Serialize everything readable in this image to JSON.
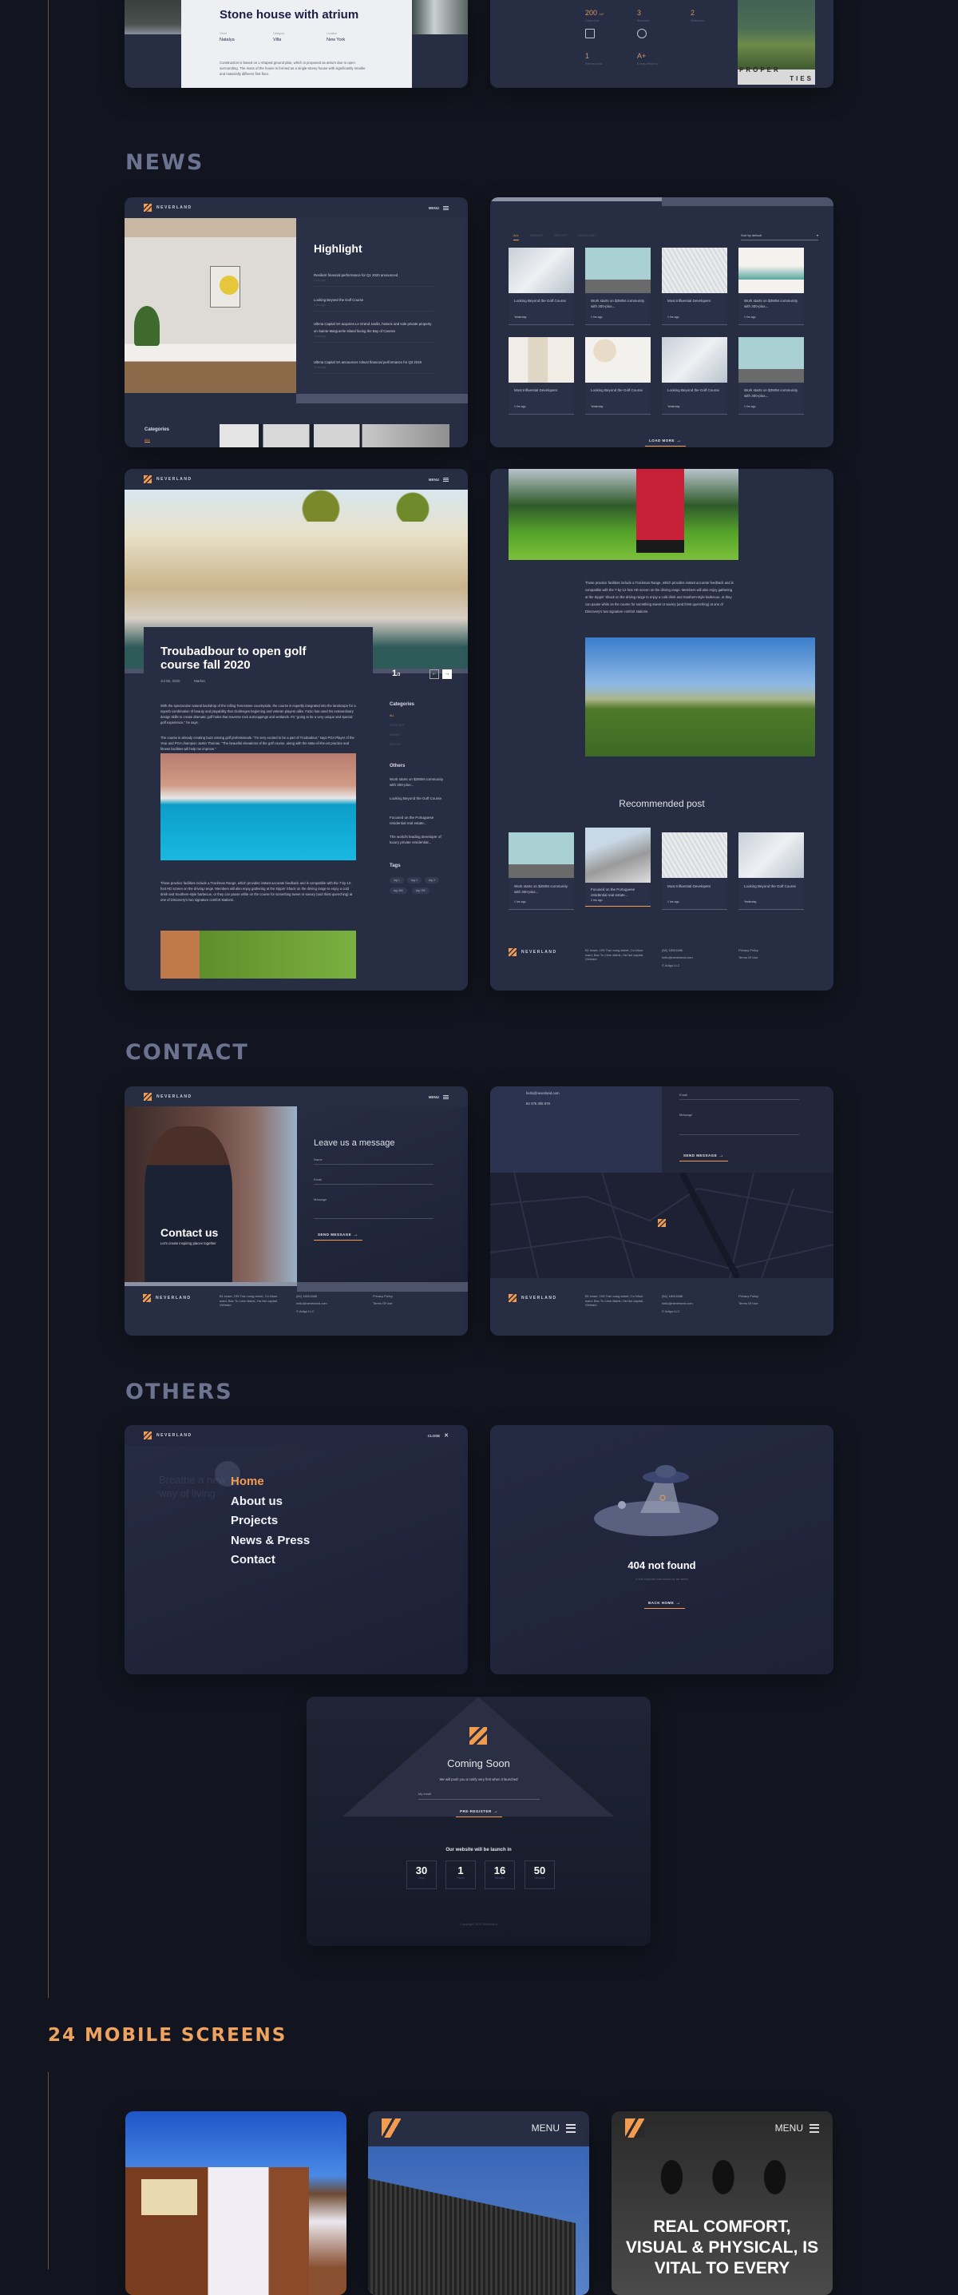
{
  "brand": {
    "name": "NEVERLAND",
    "menu": "MENU",
    "close": "CLOSE",
    "accent": "#f39c50"
  },
  "sections": {
    "news": "NEWS",
    "contact": "CONTACT",
    "others": "OTHERS",
    "mobile": "24 MOBILE SCREENS"
  },
  "project": {
    "title": "Stone house with atrium",
    "meta": [
      {
        "label": "Client",
        "value": "Natalya"
      },
      {
        "label": "Category",
        "value": "Villa"
      },
      {
        "label": "Location",
        "value": "New York"
      }
    ],
    "description": "Construction is based on L-shaped ground plan, which is proposed as atrium due to open surrounding. The mass of the house is formed as a single-storey house with significantly smaller and materially different first floor."
  },
  "properties": {
    "stats": [
      {
        "icon": "area-icon",
        "value": "200",
        "unit": "m2",
        "label": "Gross Area"
      },
      {
        "icon": "bed-icon",
        "value": "3",
        "label": "Bedrooms"
      },
      {
        "icon": "bath-icon",
        "value": "2",
        "label": "Restrooms"
      },
      {
        "icon": "garage-icon",
        "value": "1",
        "label": "Parking spots"
      },
      {
        "icon": "energy-icon",
        "value": "A+",
        "label": "Energy efficiency"
      }
    ],
    "image_caption_1": "PROPER",
    "image_caption_2": "TIES"
  },
  "highlight": {
    "title": "Highlight",
    "items": [
      {
        "title": "Resilient financial performance for Q1 2020 announced",
        "time": "1 hrs ago"
      },
      {
        "title": "Looking Beyond the Golf Course",
        "time": "3 hrs ago"
      },
      {
        "title": "Ultima Capital SA acquires Le Grand Jardin, historic and sole private property on Sainte-Marguerite Island facing the Bay of Cannes",
        "time": "Yesterday"
      },
      {
        "title": "Ultima Capital SA announces robust financial performance for Q3 2019",
        "time": "Yesterday"
      }
    ],
    "categories_title": "Categories",
    "categories_first": "ALL"
  },
  "news_list": {
    "tabs": [
      "ALL",
      "MARKET",
      "REPORT",
      "HIGH LIGHT"
    ],
    "sort": "Sort by default",
    "items": [
      {
        "title": "Looking Beyond the Golf Course",
        "time": "Yesterday"
      },
      {
        "title": "Work starts on $250M community with 300-plus...",
        "time": "1 hrs ago"
      },
      {
        "title": "Most Influential Developers",
        "time": "1 hrs ago"
      },
      {
        "title": "Work starts on $250M community with 300-plus...",
        "time": "1 hrs ago"
      },
      {
        "title": "Most Influential Developers",
        "time": "1 hrs ago"
      },
      {
        "title": "Looking Beyond the Golf Course",
        "time": "Yesterday"
      },
      {
        "title": "Looking Beyond the Golf Course",
        "time": "Yesterday"
      },
      {
        "title": "Work starts on $250M community with 300-plus...",
        "time": "1 hrs ago"
      }
    ],
    "load_more": "LOAD MORE"
  },
  "article": {
    "title": "Troubadbour to open golf course fall 2020",
    "date": "Jul 06, 2020",
    "category": "Market",
    "slide_current": "1",
    "slide_total": "/3",
    "p1": "With the spectacular natural backdrop of the rolling Tennessee countryside, the course is expertly integrated into the landscape for a superb combination of beauty and playability that challenges beginning and veteran players alike. Fazio has used his extraordinary design skills to create dramatic golf holes that traverse rock outcroppings and wetlands. It's \"going to be a very unique and special golf experience,\" he says.",
    "p2": "The course is already creating buzz among golf professionals. \"I'm very excited to be a part of Troubadour,\" says PGA Player of the Year and PGA champion Justin Thomas. \"The beautiful elevations of the golf course, along with the state-of-the-art practice and fitness facilities will help me improve.\"",
    "p3": "Those practice facilities include a Trackman Range, which provides instant accurate feedback and is compatible with the 7-by-12-foot HD screen on the driving range. Members will also enjoy gathering at the Sippin' Shack on the driving range to enjoy a cold drink and Southern-style barbecue, or they can pause while on the course for something sweet or savory (and thirst quenching) at one of Discovery's two signature comfort stations.",
    "categories_title": "Categories",
    "categories": [
      "ALL",
      "HIGHLIGHT",
      "MARKET",
      "REPORT"
    ],
    "others_title": "Others",
    "others": [
      "Work starts on $250M community with 300-plus...",
      "Looking Beyond the Golf Course",
      "Focused on the Portuguese residential real estate...",
      "The world's leading developer of luxury private residential..."
    ],
    "tags_title": "Tags",
    "tags": [
      "tag 1",
      "tag 2",
      "tag 3",
      "tag 456",
      "tag 789"
    ]
  },
  "recommended": {
    "title": "Recommended post",
    "items": [
      {
        "title": "Work starts on $250M community with 300-plus...",
        "time": "1 hrs ago"
      },
      {
        "title": "Focused on the Portuguese residential real estate...",
        "time": "2 hrs ago"
      },
      {
        "title": "Most Influential Developers",
        "time": "1 hrs ago"
      },
      {
        "title": "Looking Beyond the Golf Course",
        "time": "Yesterday"
      }
    ]
  },
  "footer": {
    "address": "B1 tower, 195 Tran cung street, Co Nhue ward, Bac Tu Liem distric, Ha Noi capital, Vietnam",
    "phone": "(84) 18001688",
    "email": "hello@neverland.com",
    "copyright": "© Adigo LLC",
    "privacy": "Privacy Policy",
    "terms": "Terms Of Use"
  },
  "contact": {
    "hero_title": "Contact us",
    "hero_sub": "Let's create inspiring places together",
    "form_title": "Leave us a message",
    "name_label": "Name",
    "email_label": "Email",
    "message_label": "Message",
    "send": "SEND MESSAGE",
    "info_email": "hello@neverland.com",
    "info_phone": "84 375 305 878"
  },
  "menu_overlay": {
    "items": [
      "Home",
      "About us",
      "Projects",
      "News & Press",
      "Contact"
    ],
    "bg_text": "Breathe a new way of living"
  },
  "not_found": {
    "title": "404 not found",
    "subtitle": "A link surprise has stolen by an alien!",
    "button": "BACK HOME"
  },
  "coming_soon": {
    "title": "Coming Soon",
    "subtitle": "We will push you a notify very first when it launched",
    "email_placeholder": "My email",
    "button": "PRE-REGISTER",
    "countdown_title": "Our website will be launch in",
    "countdown": [
      {
        "value": "30",
        "label": "Days"
      },
      {
        "value": "1",
        "label": "Hours"
      },
      {
        "value": "16",
        "label": "Minutes"
      },
      {
        "value": "50",
        "label": "Seconds"
      }
    ],
    "copyright": "Copyright 2020 Neverland"
  },
  "mobile": {
    "menu": "MENU",
    "headline": "REAL COMFORT, VISUAL & PHYSICAL, IS VITAL TO EVERY"
  }
}
